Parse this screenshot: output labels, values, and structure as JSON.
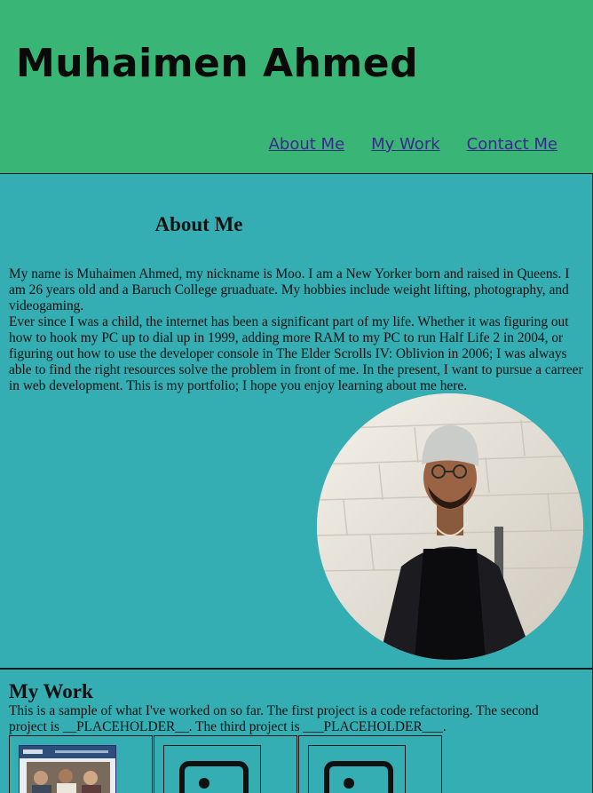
{
  "header": {
    "title": "Muhaimen Ahmed",
    "nav": [
      {
        "label": "About Me"
      },
      {
        "label": "My Work"
      },
      {
        "label": "Contact Me"
      }
    ]
  },
  "about": {
    "heading": "About Me",
    "paragraph1": "My name is Muhaimen Ahmed, my nickname is Moo. I am a New Yorker born and raised in Queens. I am 26 years old and a Baruch College gruaduate. My hobbies include weight lifting, photography, and videogaming.",
    "paragraph2": "Ever since I was a child, the internet has been a significant part of my life. Whether it was figuring out how to hook my PC up to dial up in 1999, adding more RAM to my PC to run Half Life 2 in 2004, or figuring out how to use the developer console in The Elder Scrolls IV: Oblivion in 2006; I was always able to find the right resources solve the problem in front of me. In the present, I want to pursue a carreer in web development. This is my portfolio; I hope you enjoy learning about me here."
  },
  "work": {
    "heading": "My Work",
    "description": "This is a sample of what I've worked on so far. The first project is a code refactoring. The second project is __PLACEHOLDER__. The third project is ___PLACEHOLDER___.",
    "projects": [
      {
        "icon": "project-screenshot"
      },
      {
        "icon": "image-placeholder-icon"
      },
      {
        "icon": "image-placeholder-icon"
      }
    ]
  },
  "colors": {
    "header_bg": "#39b575",
    "page_bg": "#34aeb3",
    "link": "#3b2a8c"
  }
}
